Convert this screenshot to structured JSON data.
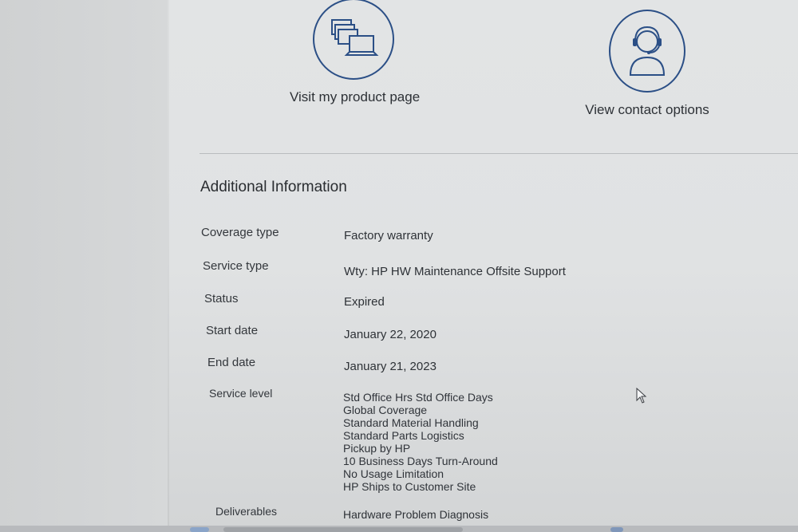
{
  "tiles": {
    "product": {
      "label": "Visit my product page",
      "icon": "laptop-stack-icon"
    },
    "contact": {
      "label": "View contact options",
      "icon": "headset-agent-icon"
    }
  },
  "additional_info": {
    "title": "Additional Information",
    "rows": [
      {
        "label": "Coverage type",
        "value": "Factory warranty"
      },
      {
        "label": "Service type",
        "value": "Wty: HP HW Maintenance Offsite Support"
      },
      {
        "label": "Status",
        "value": "Expired"
      },
      {
        "label": "Start date",
        "value": "January 22, 2020"
      },
      {
        "label": "End date",
        "value": "January 21, 2023"
      }
    ],
    "service_level": {
      "label": "Service level",
      "items": [
        "Std Office Hrs Std Office Days",
        "Global Coverage",
        "Standard Material Handling",
        "Standard Parts Logistics",
        "Pickup by HP",
        "10 Business Days Turn-Around",
        "No Usage Limitation",
        "HP Ships to Customer Site"
      ]
    },
    "deliverables": {
      "label": "Deliverables",
      "first_item": "Hardware Problem Diagnosis"
    }
  },
  "colors": {
    "icon_stroke": "#2b4f86",
    "page_background": "#e0e2e3",
    "text": "#2e3237"
  }
}
